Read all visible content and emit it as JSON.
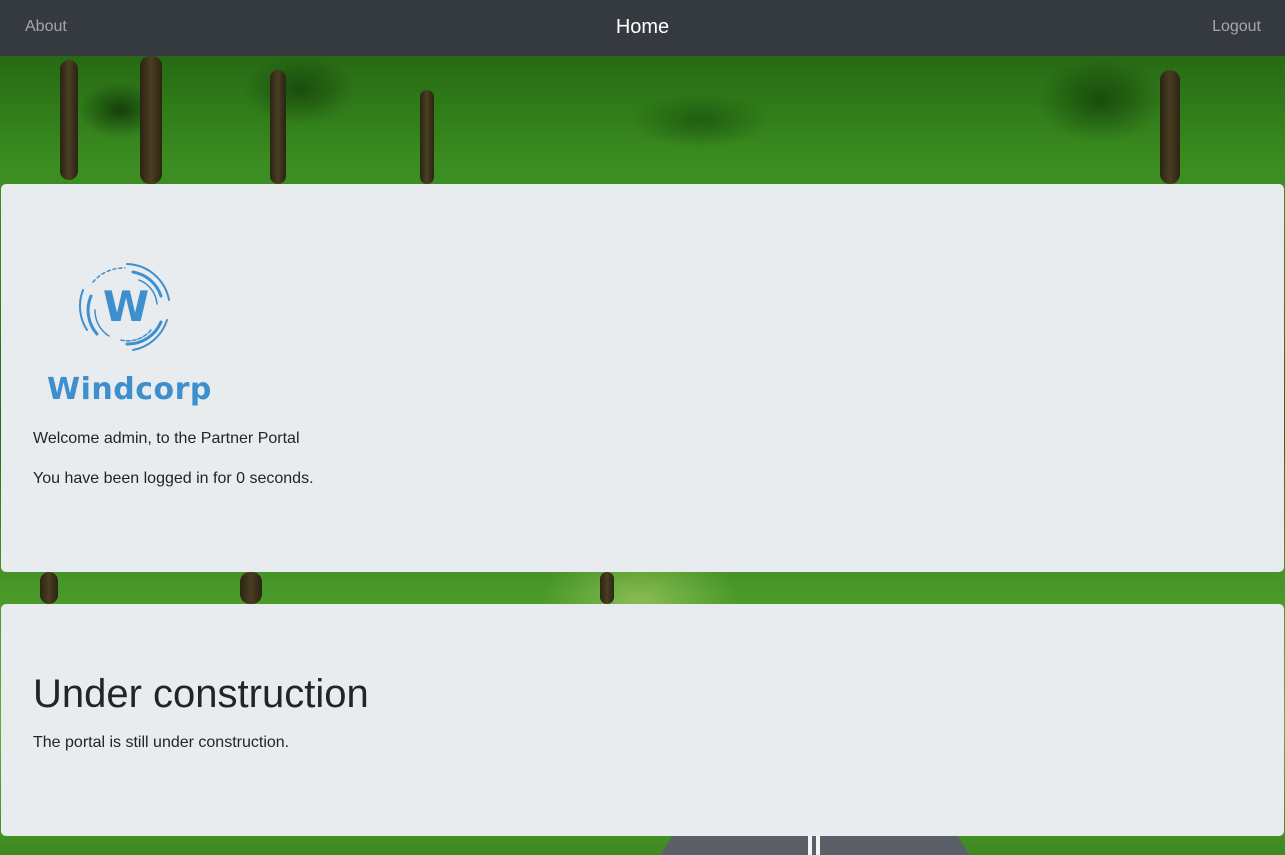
{
  "nav": {
    "about_label": "About",
    "home_label": "Home",
    "logout_label": "Logout"
  },
  "welcome_panel": {
    "logo_text": "Windcorp",
    "logo_letter": "W",
    "welcome_text": "Welcome admin, to the Partner Portal",
    "logged_in_text": "You have been logged in for 0 seconds."
  },
  "notice_panel": {
    "heading": "Under construction",
    "message": "The portal is still under construction."
  },
  "colors": {
    "navbar_bg": "#343a40",
    "panel_bg": "#e9ecef",
    "logo_blue": "#3e8fce",
    "text": "#212529"
  },
  "icons": {
    "logo_mark": "windcorp-swirl-logo"
  }
}
